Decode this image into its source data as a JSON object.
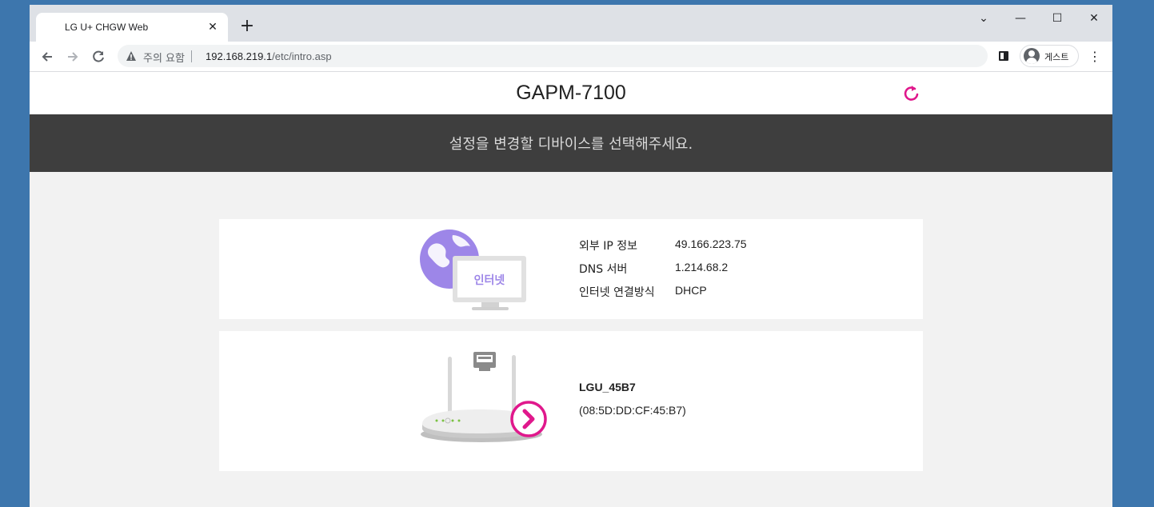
{
  "browser": {
    "tab_title": "LG U+ CHGW Web",
    "tab_close": "✕",
    "new_tab": "+",
    "window_controls": {
      "minimize": "—",
      "maximize": "☐",
      "close": "✕",
      "tab_search": "⌄"
    },
    "security_warning": "주의 요함",
    "url_host": "192.168.219.1",
    "url_path": "/etc/intro.asp",
    "profile_label": "게스트",
    "icons": [
      "back-icon",
      "forward-icon",
      "reload-icon",
      "warning-icon",
      "side-panel-icon",
      "profile-icon",
      "menu-icon"
    ]
  },
  "header": {
    "title": "GAPM-7100",
    "refresh_icon": "refresh-icon",
    "accent_color": "#e0188c"
  },
  "banner": {
    "text": "설정을 변경할 디바이스를 선택해주세요."
  },
  "internet": {
    "badge": "인터넷",
    "rows": [
      {
        "label": "외부 IP 정보",
        "value": "49.166.223.75"
      },
      {
        "label": "DNS 서버",
        "value": "1.214.68.2"
      },
      {
        "label": "인터넷 연결방식",
        "value": "DHCP"
      }
    ]
  },
  "device": {
    "name": "LGU_45B7",
    "mac": "(08:5D:DD:CF:45:B7)"
  }
}
